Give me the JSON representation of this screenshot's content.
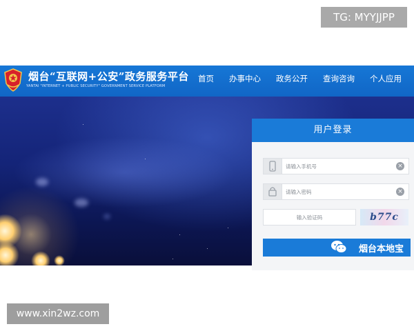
{
  "overlay": {
    "tg_badge": "TG: MYYJJPP",
    "watermark": "www.xin2wz.com"
  },
  "header": {
    "site_title": "烟台“互联网+公安”政务服务平台",
    "site_subtitle": "YANTAI \"INTERNET + PUBLIC SECURITY\" GOVERNMENT SERVICE PLATFORM",
    "nav": [
      "首页",
      "办事中心",
      "政务公开",
      "查询咨询",
      "个人应用"
    ]
  },
  "login": {
    "title": "用户登录",
    "phone_placeholder": "请输入手机号",
    "password_placeholder": "请输入密码",
    "captcha_placeholder": "输入验证码",
    "captcha_text": "b77c",
    "button_label": "烟台本地宝"
  },
  "colors": {
    "brand_blue": "#1a7bd8",
    "hero_dark": "#0c1652",
    "panel_bg": "#f4f5f7"
  },
  "icons": [
    "police-emblem-icon",
    "phone-icon",
    "lock-icon",
    "clear-icon",
    "wechat-icon"
  ]
}
